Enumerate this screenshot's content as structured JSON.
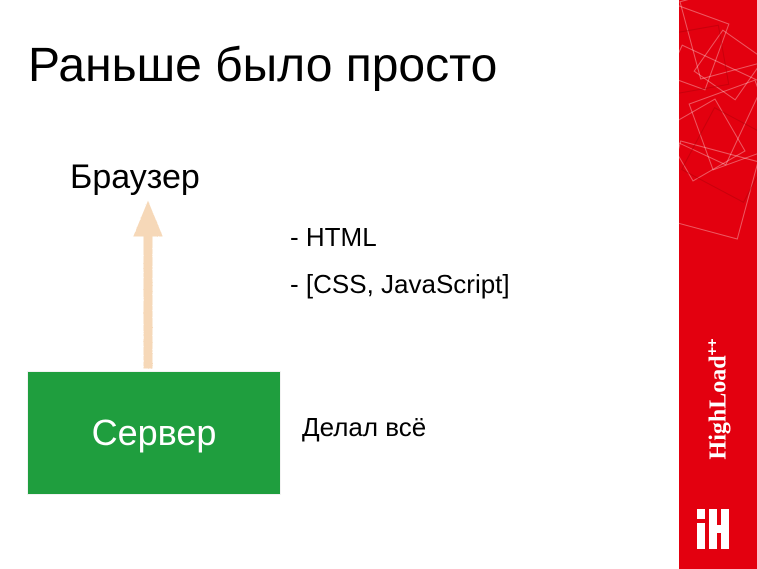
{
  "title": "Раньше было просто",
  "browser_label": "Браузер",
  "bullets": [
    "HTML",
    "[CSS, JavaScript]"
  ],
  "server_box_label": "Сервер",
  "server_caption": "Делал всё",
  "brand": "HighLoad",
  "brand_suffix": "++",
  "colors": {
    "sidebar": "#e3000f",
    "server_box": "#1f9e3e",
    "arrow": "#f6d8b8"
  }
}
